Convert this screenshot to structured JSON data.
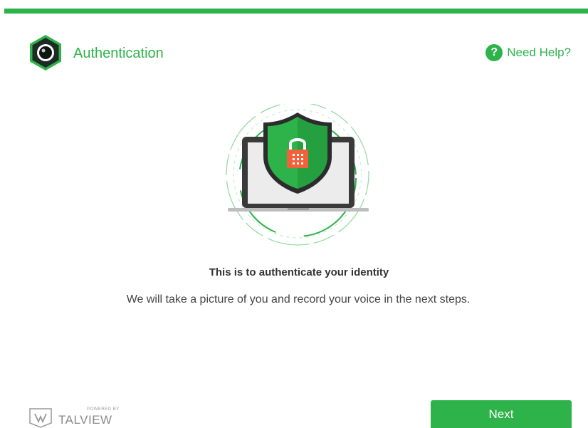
{
  "header": {
    "title": "Authentication",
    "help_label": "Need Help?",
    "help_icon_glyph": "?"
  },
  "main": {
    "heading": "This is to authenticate your identity",
    "description": "We will take a picture of you and record your voice in the next steps."
  },
  "footer": {
    "powered_by": "POWERED BY",
    "brand_name": "TALVIEW",
    "next_label": "Next"
  },
  "icons": {
    "app_logo": "camera-hexagon-icon",
    "help": "question-circle-icon",
    "illustration": "laptop-shield-lock-illustration",
    "brand": "talview-logo-icon"
  },
  "colors": {
    "accent": "#2db34a",
    "shield": "#2db34a",
    "lock": "#f2613a",
    "logo_hex": "#1a1a1a"
  }
}
